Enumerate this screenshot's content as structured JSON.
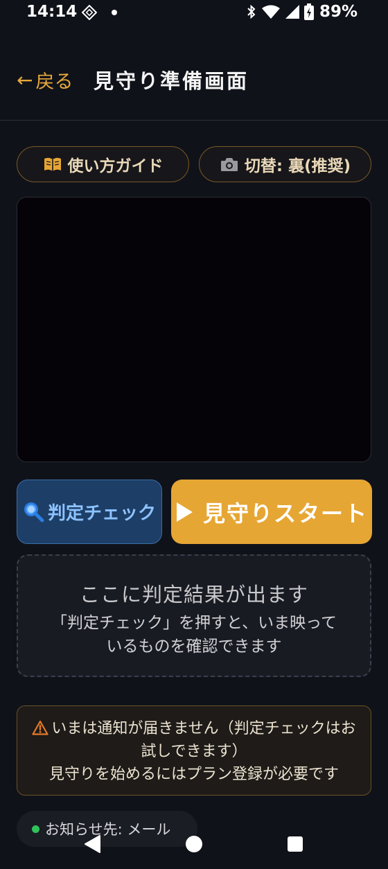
{
  "status_bar": {
    "time": "14:14",
    "battery": "89%",
    "icons": [
      "app-icon",
      "notification-dot",
      "bluetooth-icon",
      "wifi-icon",
      "signal-icon",
      "battery-icon"
    ]
  },
  "header": {
    "back_arrow": "←",
    "back_label": "戻る",
    "title": "見守り準備画面"
  },
  "toolbar": {
    "guide_label": "使い方ガイド",
    "camera_label": "切替: 裏(推奨)"
  },
  "actions": {
    "check_label": "判定チェック",
    "start_label": "見守りスタート"
  },
  "result": {
    "title": "ここに判定結果が出ます",
    "description": "「判定チェック」を押すと、いま映っているものを確認できます"
  },
  "warning": {
    "line1": "いまは通知が届きません（判定チェックはお試しできます）",
    "line2": "見守りを始めるにはプラン登録が必要です"
  },
  "notify": {
    "label": "お知らせ先: メール"
  },
  "colors": {
    "background": "#10121a",
    "accent": "#e6a634",
    "check_blue": "#1d3e66",
    "status_green": "#2fc35a"
  }
}
